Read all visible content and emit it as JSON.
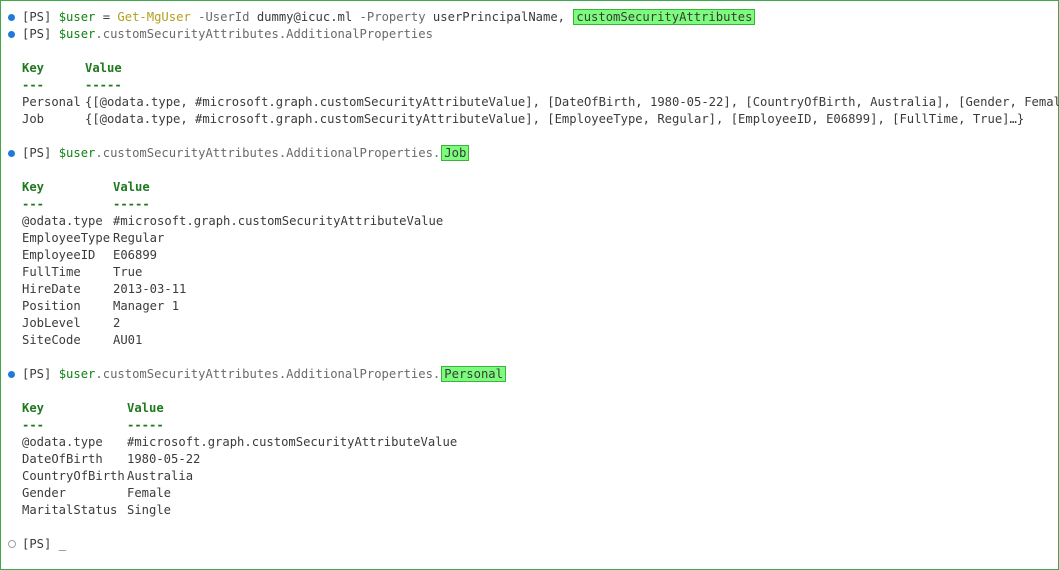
{
  "prompt": "[PS]",
  "cmd1": {
    "var": "$user",
    "eq": " = ",
    "cmdlet": "Get-MgUser",
    "p1": " -UserId",
    "p1_val": " dummy@icuc.ml",
    "p2": " -Property",
    "p2_val": " userPrincipalName,",
    "highlight": "customSecurityAttributes"
  },
  "cmd2": {
    "var": "$user",
    "rest": ".customSecurityAttributes.AdditionalProperties"
  },
  "table1": {
    "key_header": "Key",
    "value_header": "Value",
    "key_dash": "---",
    "value_dash": "-----",
    "rows": [
      {
        "key": "Personal",
        "value": "{[@odata.type, #microsoft.graph.customSecurityAttributeValue], [DateOfBirth, 1980-05-22], [CountryOfBirth, Australia], [Gender, Female]…}"
      },
      {
        "key": "Job",
        "value": "{[@odata.type, #microsoft.graph.customSecurityAttributeValue], [EmployeeType, Regular], [EmployeeID, E06899], [FullTime, True]…}"
      }
    ]
  },
  "cmd3": {
    "var": "$user",
    "rest": ".customSecurityAttributes.AdditionalProperties.",
    "highlight": "Job"
  },
  "table2": {
    "key_header": "Key",
    "value_header": "Value",
    "key_dash": "---",
    "value_dash": "-----",
    "rows": [
      {
        "key": "@odata.type",
        "value": "#microsoft.graph.customSecurityAttributeValue"
      },
      {
        "key": "EmployeeType",
        "value": "Regular"
      },
      {
        "key": "EmployeeID",
        "value": "E06899"
      },
      {
        "key": "FullTime",
        "value": "True"
      },
      {
        "key": "HireDate",
        "value": "2013-03-11"
      },
      {
        "key": "Position",
        "value": "Manager 1"
      },
      {
        "key": "JobLevel",
        "value": "2"
      },
      {
        "key": "SiteCode",
        "value": "AU01"
      }
    ]
  },
  "cmd4": {
    "var": "$user",
    "rest": ".customSecurityAttributes.AdditionalProperties.",
    "highlight": "Personal"
  },
  "table3": {
    "key_header": "Key",
    "value_header": "Value",
    "key_dash": "---",
    "value_dash": "-----",
    "rows": [
      {
        "key": "@odata.type",
        "value": "#microsoft.graph.customSecurityAttributeValue"
      },
      {
        "key": "DateOfBirth",
        "value": "1980-05-22"
      },
      {
        "key": "CountryOfBirth",
        "value": "Australia"
      },
      {
        "key": "Gender",
        "value": "Female"
      },
      {
        "key": "MaritalStatus",
        "value": "Single"
      }
    ]
  },
  "final_prompt": {
    "prompt": "[PS]",
    "cursor": "_"
  },
  "colors": {
    "border": "#3ea94a",
    "highlight": "#7cfc7c",
    "variable": "#118311",
    "cmdlet": "#b1a022",
    "header": "#1f7a1f",
    "dot": "#1f7ad8"
  }
}
